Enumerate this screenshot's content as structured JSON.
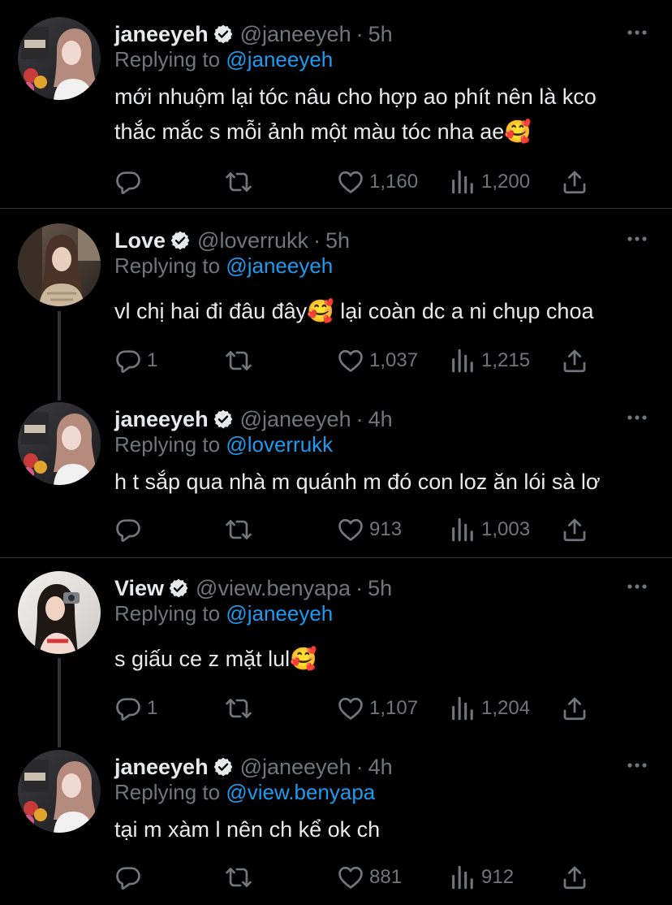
{
  "colors": {
    "background": "#000000",
    "text_primary": "#e7e9ea",
    "text_secondary": "#71767b",
    "accent_link": "#1d9bf0",
    "divider": "#2f3336"
  },
  "tweets": [
    {
      "name": "janeeyeh",
      "verified": true,
      "handle": "@janeeyeh",
      "separator": "·",
      "time": "5h",
      "reply_prefix": "Replying to ",
      "reply_to": "@janeeyeh",
      "text": "mới nhuộm lại tóc nâu cho hợp ao phít nên là kco\nthắc mắc s mỗi ảnh một màu tóc nha ae🥰",
      "replies": "",
      "retweets": "",
      "likes": "1,160",
      "views": "1,200",
      "icons": [
        "reply-icon",
        "retweet-icon",
        "like-icon",
        "views-icon",
        "share-icon",
        "more-icon",
        "verified-badge-icon"
      ]
    },
    {
      "name": "Love",
      "verified": true,
      "handle": "@loverrukk",
      "separator": "·",
      "time": "5h",
      "reply_prefix": "Replying to ",
      "reply_to": "@janeeyeh",
      "text": "vl chị hai đi đâu đây🥰 lại coàn dc a ni chụp choa",
      "replies": "1",
      "retweets": "",
      "likes": "1,037",
      "views": "1,215"
    },
    {
      "name": "janeeyeh",
      "verified": true,
      "handle": "@janeeyeh",
      "separator": "·",
      "time": "4h",
      "reply_prefix": "Replying to ",
      "reply_to": "@loverrukk",
      "text": "h t sắp qua nhà m quánh m đó con loz ăn lói sà lơ",
      "replies": "",
      "retweets": "",
      "likes": "913",
      "views": "1,003"
    },
    {
      "name": "View",
      "verified": true,
      "handle": "@view.benyapa",
      "separator": "·",
      "time": "5h",
      "reply_prefix": "Replying to ",
      "reply_to": "@janeeyeh",
      "text": "s giấu ce z mặt lul🥰",
      "replies": "1",
      "retweets": "",
      "likes": "1,107",
      "views": "1,204"
    },
    {
      "name": "janeeyeh",
      "verified": true,
      "handle": "@janeeyeh",
      "separator": "·",
      "time": "4h",
      "reply_prefix": "Replying to ",
      "reply_to": "@view.benyapa",
      "text": "tại m xàm l nên ch kể ok ch",
      "replies": "",
      "retweets": "",
      "likes": "881",
      "views": "912"
    }
  ]
}
